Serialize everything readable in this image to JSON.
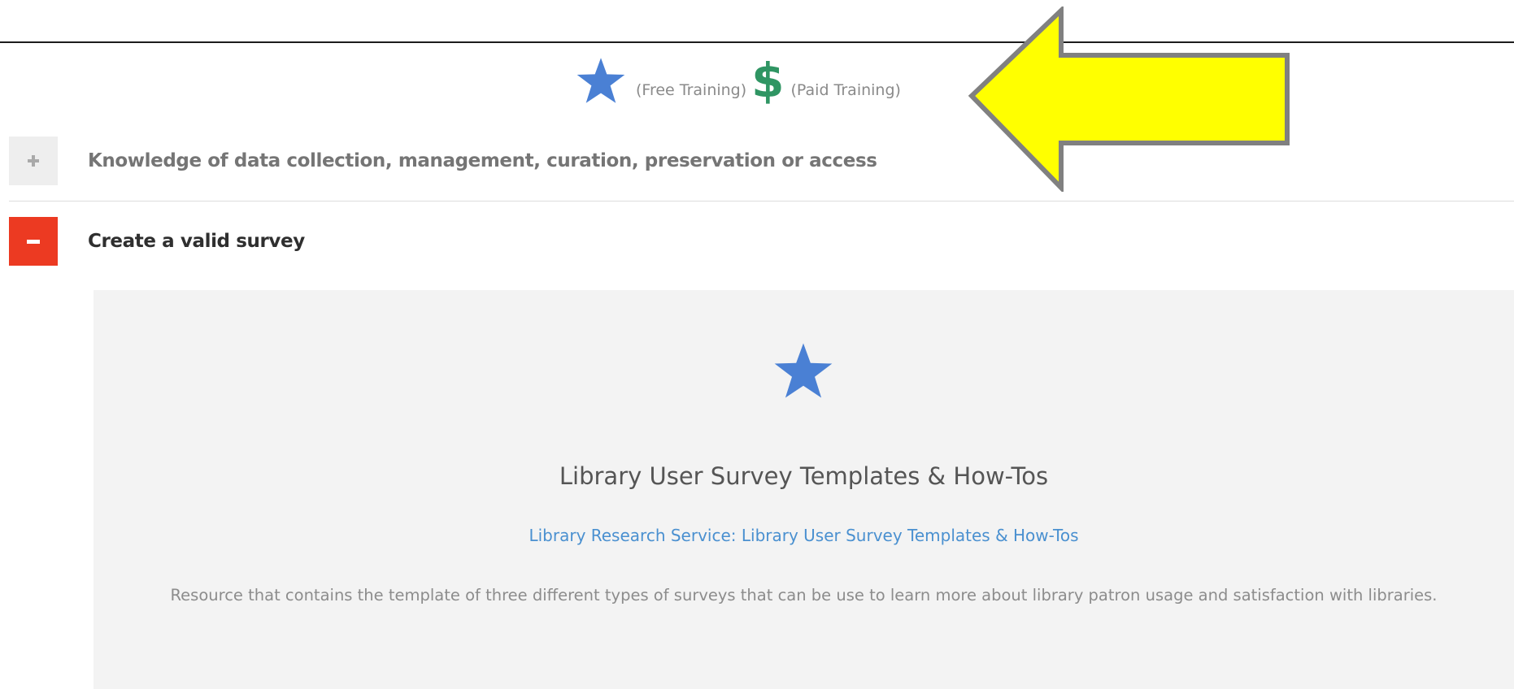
{
  "legend": {
    "free_label": "(Free Training)",
    "dollar_symbol": "$",
    "paid_label": "(Paid Training)",
    "star_color": "#4a80d4",
    "dollar_color": "#2f9563"
  },
  "accordion": {
    "items": [
      {
        "title": "Knowledge of data collection, management, curation, preservation or access",
        "state": "collapsed"
      },
      {
        "title": "Create a valid survey",
        "state": "expanded"
      }
    ],
    "expanded_color": "#ec3a22"
  },
  "resource": {
    "type_icon": "star-icon",
    "title": "Library User Survey Templates & How-Tos",
    "link_text": "Library Research Service: Library User Survey Templates & How-Tos",
    "description": "Resource that contains the template of three different types of surveys that can be use to learn more about library patron usage and satisfaction with libraries."
  },
  "annotation": {
    "arrow_color": "#ffff00",
    "arrow_icon": "left-arrow-annotation-icon"
  }
}
